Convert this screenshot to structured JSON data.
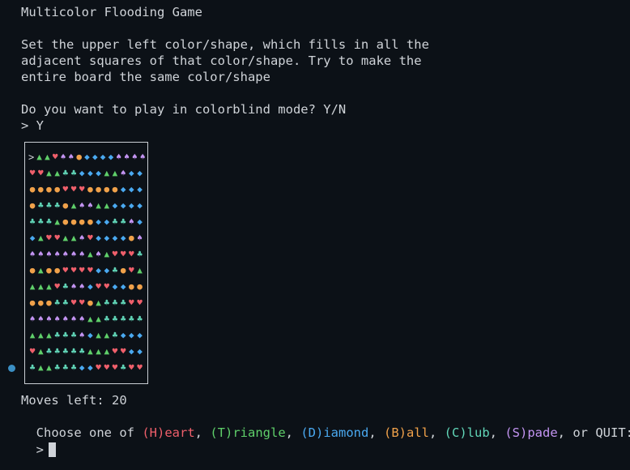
{
  "terminal": {
    "title": "Multicolor Flooding Game",
    "intro": [
      "Set the upper left color/shape, which fills in all the",
      "adjacent squares of that color/shape. Try to make the",
      "entire board the same color/shape"
    ],
    "question": "Do you want to play in colorblind mode? Y/N",
    "answer": "> Y",
    "moves_left": "Moves left: 20",
    "choose_prefix": "Choose one of ",
    "options": [
      {
        "label": "(H)eart",
        "color": "#ef5f6b"
      },
      {
        "label": "(T)riangle",
        "color": "#5fcf6a"
      },
      {
        "label": "(D)iamond",
        "color": "#4aa9f0"
      },
      {
        "label": "(B)all",
        "color": "#f0a14a"
      },
      {
        "label": "(C)lub",
        "color": "#61d6b8"
      },
      {
        "label": "(S)pade",
        "color": "#c394f2"
      }
    ],
    "choose_suffix": "or QUIT:",
    "prompt": ">"
  },
  "board": {
    "start_marker": ">",
    "symbols": {
      "H": "♥",
      "T": "▲",
      "D": "◆",
      "B": "●",
      "C": "♣",
      "S": "♠"
    },
    "colors": {
      "H": "#ef5f6b",
      "T": "#5fcf6a",
      "D": "#4aa9f0",
      "B": "#f0a14a",
      "C": "#61d6b8",
      "S": "#c394f2"
    },
    "rows": [
      "TTHSSBDDDDSSSSS",
      "HHTTCCDDDTTSDDD",
      "BBBBHHHBBBBDDDD",
      "BCCCBTSSTTDDDDS",
      "CCCTBBBBDDCCSDD",
      "DTHHTTSHDDDDBSS",
      "SSSSSSSTSTHHHCC",
      "BTBBHHHHDDCBHTT",
      "TTTHCSSDHHDDBBB",
      "BBBCCHHBTCCCHHH",
      "SSSSSSSTTCCCCCC",
      "TTTCCCSDTTCDDDH",
      "HTCCCCCTTTHHDDD",
      "CTTCCCDDHHHCHHH"
    ],
    "indicator_color": "#3b8fc4"
  }
}
